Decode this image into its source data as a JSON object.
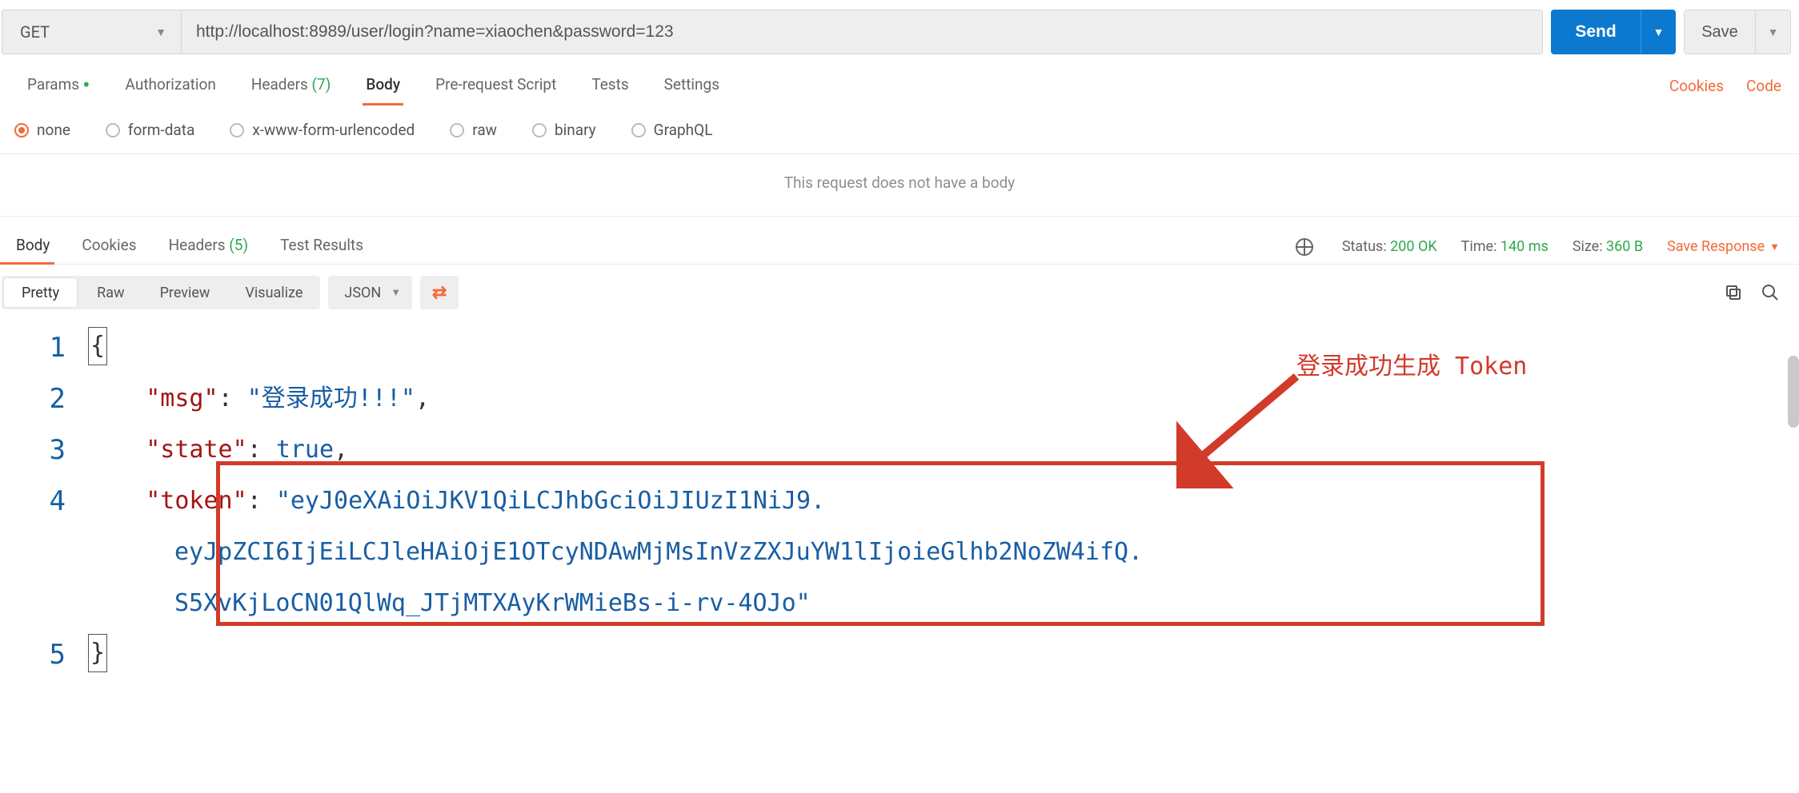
{
  "request": {
    "method": "GET",
    "url": "http://localhost:8989/user/login?name=xiaochen&password=123",
    "send_label": "Send",
    "save_label": "Save"
  },
  "req_tabs": {
    "params": "Params",
    "auth": "Authorization",
    "headers": "Headers",
    "headers_count": "(7)",
    "body": "Body",
    "prerequest": "Pre-request Script",
    "tests": "Tests",
    "settings": "Settings"
  },
  "req_links": {
    "cookies": "Cookies",
    "code": "Code"
  },
  "body_types": {
    "none": "none",
    "formdata": "form-data",
    "urlencoded": "x-www-form-urlencoded",
    "raw": "raw",
    "binary": "binary",
    "graphql": "GraphQL"
  },
  "no_body_msg": "This request does not have a body",
  "resp_tabs": {
    "body": "Body",
    "cookies": "Cookies",
    "headers": "Headers",
    "headers_count": "(5)",
    "tests": "Test Results"
  },
  "resp_meta": {
    "status_label": "Status:",
    "status_value": "200 OK",
    "time_label": "Time:",
    "time_value": "140 ms",
    "size_label": "Size:",
    "size_value": "360 B",
    "save_response": "Save Response"
  },
  "resp_toolbar": {
    "pretty": "Pretty",
    "raw": "Raw",
    "preview": "Preview",
    "visualize": "Visualize",
    "format": "JSON"
  },
  "json": {
    "ln1": "1",
    "ln2": "2",
    "ln3": "3",
    "ln4": "4",
    "ln5": "5",
    "open_brace": "{",
    "close_brace": "}",
    "k_msg": "\"msg\"",
    "v_msg": "\"登录成功!!!\"",
    "k_state": "\"state\"",
    "v_state": "true",
    "k_token": "\"token\"",
    "v_token_l1": "\"eyJ0eXAiOiJKV1QiLCJhbGciOiJIUzI1NiJ9.",
    "v_token_l2": "eyJpZCI6IjEiLCJleHAiOjE1OTcyNDAwMjMsInVzZXJuYW1lIjoieGlhb2NoZW4ifQ.",
    "v_token_l3": "S5XvKjLoCN01QlWq_JTjMTXAyKrWMieBs-i-rv-4OJo\""
  },
  "annotation": "登录成功生成 Token"
}
